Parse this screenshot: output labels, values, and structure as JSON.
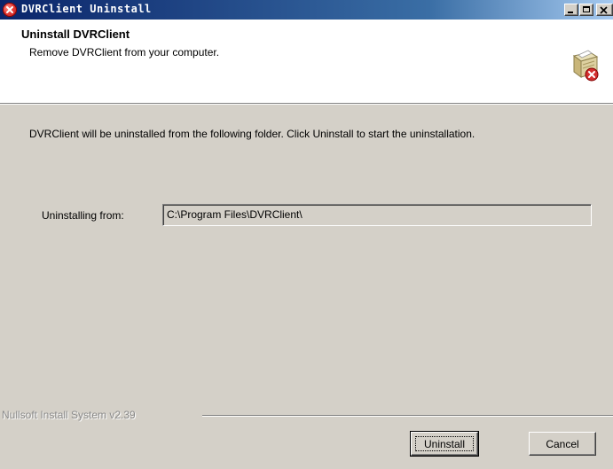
{
  "window": {
    "title": "DVRClient Uninstall",
    "icon": "error-x-icon"
  },
  "titlebar_buttons": {
    "minimize": "minimize-icon",
    "maximize": "maximize-icon",
    "close": "close-icon"
  },
  "header": {
    "title": "Uninstall DVRClient",
    "subtitle": "Remove DVRClient from your computer.",
    "icon": "uninstall-box-icon"
  },
  "body": {
    "description": "DVRClient will be uninstalled from the following folder. Click Uninstall to start the uninstallation.",
    "from_label": "Uninstalling from:",
    "from_value": "C:\\Program Files\\DVRClient\\"
  },
  "footer": {
    "branding": "Nullsoft Install System v2.39",
    "uninstall_label": "Uninstall",
    "cancel_label": "Cancel"
  },
  "colors": {
    "titlebar_start": "#0a246a",
    "titlebar_end": "#a6caf0",
    "face": "#d4d0c8"
  }
}
